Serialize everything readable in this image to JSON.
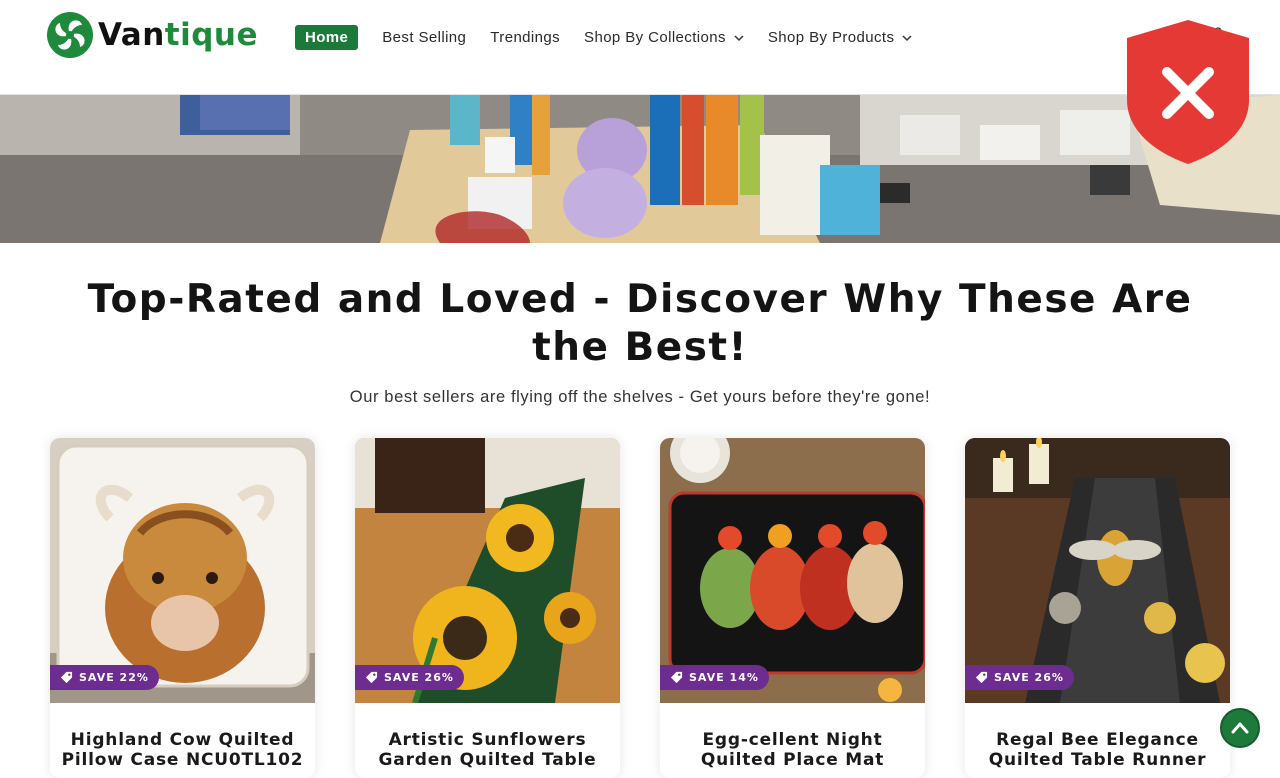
{
  "brand": {
    "name_part1": "Van",
    "name_part2": "tique",
    "color_green": "#1f8a3b"
  },
  "nav": {
    "items": [
      {
        "label": "Home",
        "active": true,
        "dropdown": false
      },
      {
        "label": "Best Selling",
        "active": false,
        "dropdown": false
      },
      {
        "label": "Trendings",
        "active": false,
        "dropdown": false
      },
      {
        "label": "Shop By Collections",
        "active": false,
        "dropdown": true
      },
      {
        "label": "Shop By Products",
        "active": false,
        "dropdown": true
      }
    ]
  },
  "icons": {
    "account": "account-icon",
    "security_badge": "shield-x-icon",
    "scroll_top": "chevron-up-icon",
    "tag": "tag-icon"
  },
  "section": {
    "title": "Top-Rated and Loved - Discover Why These Are the Best!",
    "subtitle": "Our best sellers are flying off the shelves - Get yours before they're gone!"
  },
  "products": [
    {
      "save": "SAVE 22%",
      "title": "Highland Cow Quilted Pillow Case NCU0TL102"
    },
    {
      "save": "SAVE 26%",
      "title": "Artistic Sunflowers Garden Quilted Table"
    },
    {
      "save": "SAVE 14%",
      "title": "Egg-cellent Night Quilted Place Mat"
    },
    {
      "save": "SAVE 26%",
      "title": "Regal Bee Elegance Quilted Table Runner"
    }
  ],
  "colors": {
    "accent_green": "#1b7a3a",
    "save_badge": "#6d2c8f",
    "alert_red": "#e53935"
  }
}
